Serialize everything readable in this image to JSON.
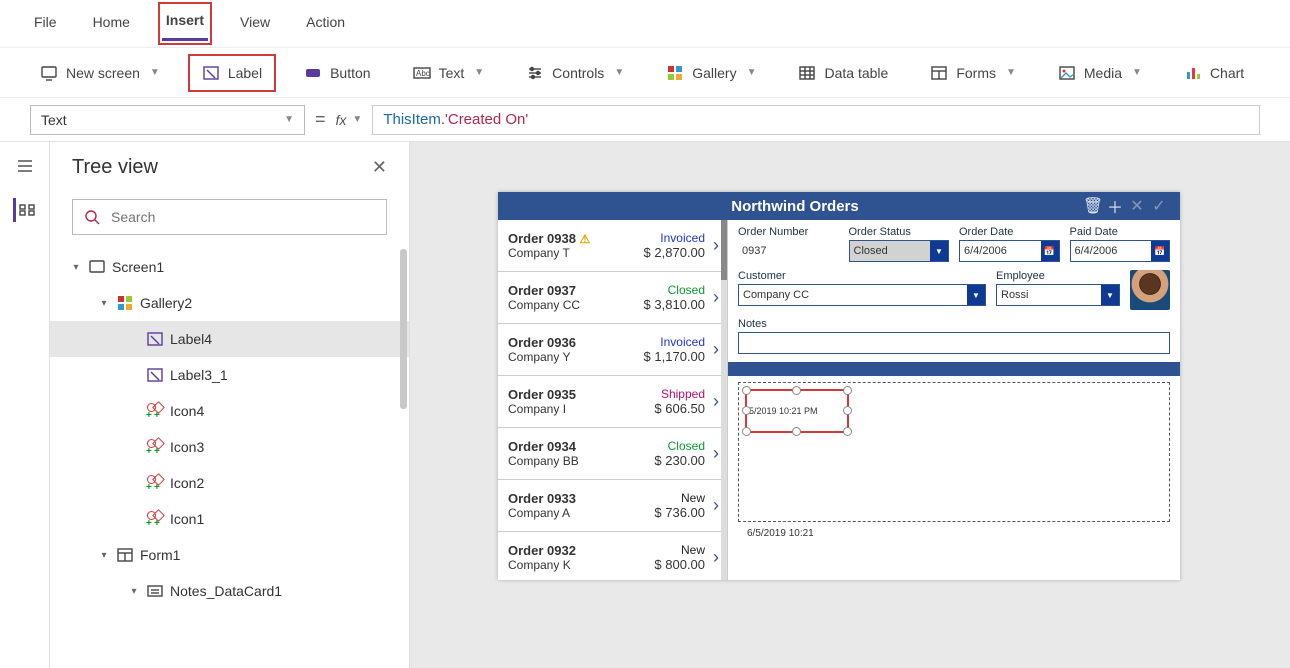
{
  "tabs": {
    "file": "File",
    "home": "Home",
    "insert": "Insert",
    "view": "View",
    "action": "Action"
  },
  "ribbon": {
    "newscreen": "New screen",
    "label": "Label",
    "button": "Button",
    "text": "Text",
    "controls": "Controls",
    "gallery": "Gallery",
    "datatable": "Data table",
    "forms": "Forms",
    "media": "Media",
    "charts": "Chart"
  },
  "formula": {
    "property": "Text",
    "equals": "=",
    "fx": "fx",
    "token1": "ThisItem",
    "token2": ".'Created On'"
  },
  "treepanel": {
    "title": "Tree view",
    "search_placeholder": "Search",
    "items": [
      {
        "label": "Screen1",
        "depth": 0,
        "icon": "screen",
        "expanded": true
      },
      {
        "label": "Gallery2",
        "depth": 1,
        "icon": "gallery",
        "expanded": true
      },
      {
        "label": "Label4",
        "depth": 2,
        "icon": "label",
        "selected": true
      },
      {
        "label": "Label3_1",
        "depth": 2,
        "icon": "label"
      },
      {
        "label": "Icon4",
        "depth": 2,
        "icon": "iconctrl"
      },
      {
        "label": "Icon3",
        "depth": 2,
        "icon": "iconctrl"
      },
      {
        "label": "Icon2",
        "depth": 2,
        "icon": "iconctrl"
      },
      {
        "label": "Icon1",
        "depth": 2,
        "icon": "iconctrl"
      },
      {
        "label": "Form1",
        "depth": 1,
        "icon": "form",
        "expanded": true
      },
      {
        "label": "Notes_DataCard1",
        "depth": 2,
        "icon": "datacard",
        "expanded": true
      }
    ]
  },
  "app": {
    "title": "Northwind Orders",
    "form": {
      "order_number_lbl": "Order Number",
      "order_number": "0937",
      "order_status_lbl": "Order Status",
      "order_status": "Closed",
      "order_date_lbl": "Order Date",
      "order_date": "6/4/2006",
      "paid_date_lbl": "Paid Date",
      "paid_date": "6/4/2006",
      "customer_lbl": "Customer",
      "customer": "Company CC",
      "employee_lbl": "Employee",
      "employee": "Rossi",
      "notes_lbl": "Notes"
    },
    "new_label_text": "5/2019 10:21 PM",
    "footer_ts": "6/5/2019 10:21",
    "orders": [
      {
        "name": "Order 0938",
        "company": "Company T",
        "status": "Invoiced",
        "price": "$ 2,870.00",
        "warn": true
      },
      {
        "name": "Order 0937",
        "company": "Company CC",
        "status": "Closed",
        "price": "$ 3,810.00"
      },
      {
        "name": "Order 0936",
        "company": "Company Y",
        "status": "Invoiced",
        "price": "$ 1,170.00"
      },
      {
        "name": "Order 0935",
        "company": "Company I",
        "status": "Shipped",
        "price": "$ 606.50"
      },
      {
        "name": "Order 0934",
        "company": "Company BB",
        "status": "Closed",
        "price": "$ 230.00"
      },
      {
        "name": "Order 0933",
        "company": "Company A",
        "status": "New",
        "price": "$ 736.00"
      },
      {
        "name": "Order 0932",
        "company": "Company K",
        "status": "New",
        "price": "$ 800.00"
      }
    ]
  }
}
